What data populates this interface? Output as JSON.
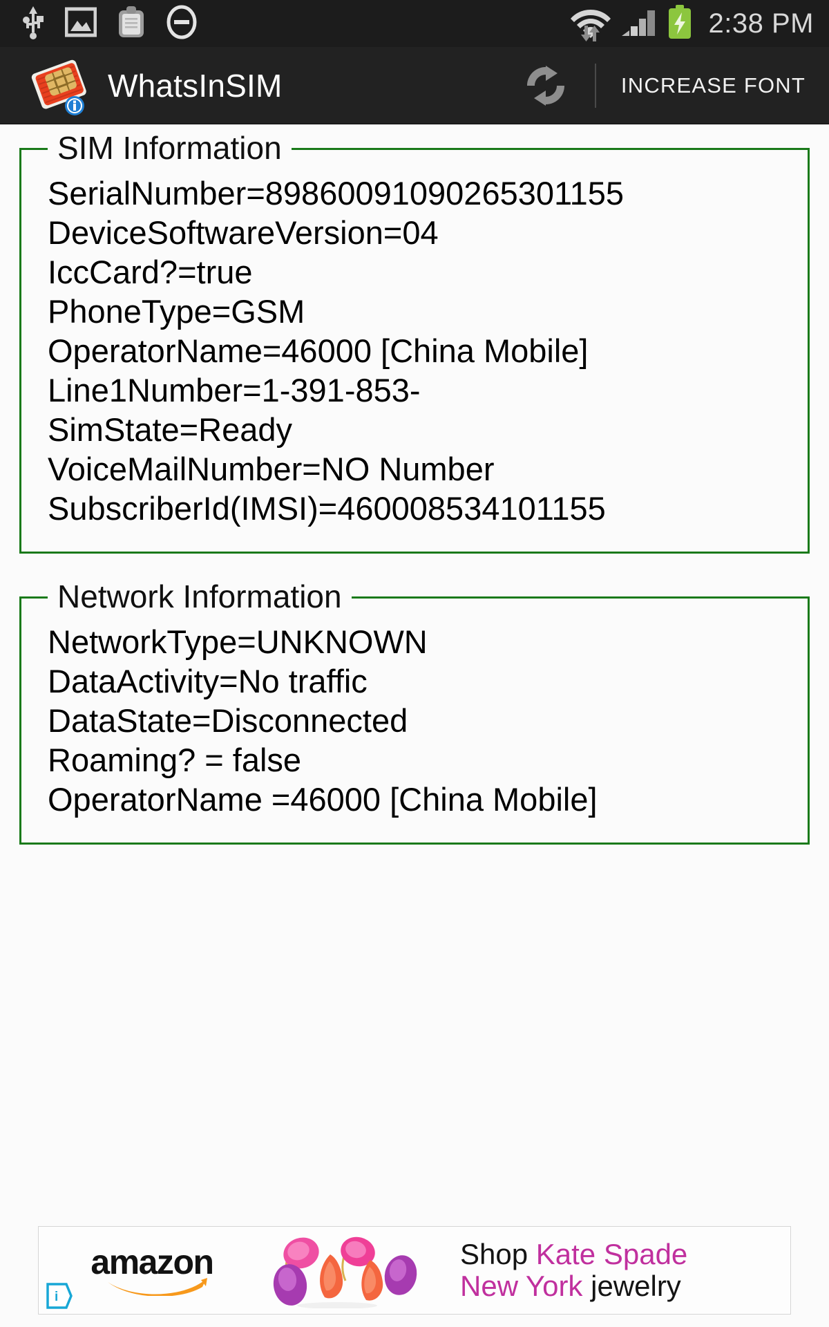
{
  "status_bar": {
    "time": "2:38 PM",
    "left_icons": [
      "usb-icon",
      "screenshot-image-icon",
      "clipboard-icon",
      "do-not-disturb-icon"
    ],
    "right_icons": [
      "wifi-transfer-icon",
      "cellular-signal-icon",
      "battery-charging-icon"
    ],
    "colors": {
      "background": "#1c1c1c",
      "icon": "#cfcfcf",
      "battery": "#8cc63e"
    }
  },
  "action_bar": {
    "app_title": "WhatsInSIM",
    "logo_icon": "sim-card-info-icon",
    "refresh_icon": "refresh-icon",
    "increase_font_label": "INCREASE FONT",
    "colors": {
      "background": "#222222",
      "text": "#ffffff"
    }
  },
  "sections": [
    {
      "legend": "SIM Information",
      "name": "sim-information",
      "lines": [
        "SerialNumber=89860091090265301155",
        "DeviceSoftwareVersion=04",
        "IccCard?=true",
        "PhoneType=GSM",
        "OperatorName=46000 [China Mobile]",
        "Line1Number=1-391-853-",
        "SimState=Ready",
        "VoiceMailNumber=NO Number",
        "SubscriberId(IMSI)=460008534101155"
      ]
    },
    {
      "legend": "Network Information",
      "name": "network-information",
      "lines": [
        "NetworkType=UNKNOWN",
        "DataActivity=No traffic",
        "DataState=Disconnected",
        "Roaming? = false",
        "OperatorName =46000 [China Mobile]"
      ]
    }
  ],
  "theme": {
    "border_green": "#1a7a1a",
    "page_background": "#fbfbfb",
    "body_text": "#000000"
  },
  "ad": {
    "brand": "amazon",
    "adchoices_icon": "adchoices-icon",
    "product_icon": "jewelry-earrings-icon",
    "line1_part1": "Shop ",
    "line1_part2": "Kate Spade",
    "line2_part1": "New York ",
    "line2_part2": "jewelry",
    "colors": {
      "pink": "#c0309e",
      "black": "#141414",
      "smile": "#f7991c"
    }
  }
}
